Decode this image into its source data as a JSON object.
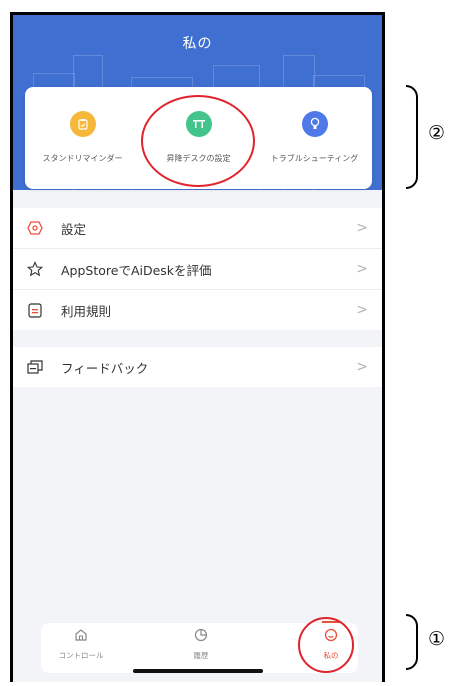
{
  "header": {
    "title": "私の"
  },
  "features": [
    {
      "label": "スタンドリマインダー",
      "icon": "clipboard-icon",
      "color": "#F5B83A"
    },
    {
      "label": "昇降デスクの設定",
      "icon": "desk-icon",
      "color": "#43C48B"
    },
    {
      "label": "トラブルシューティング",
      "icon": "bulb-icon",
      "color": "#4E79E6"
    }
  ],
  "menu": [
    {
      "label": "設定",
      "icon": "settings-icon"
    },
    {
      "label": "AppStoreでAiDeskを評価",
      "icon": "star-icon"
    },
    {
      "label": "利用規則",
      "icon": "document-icon"
    }
  ],
  "feedback": {
    "label": "フィードバック",
    "icon": "feedback-icon"
  },
  "chevron": ">",
  "tabs": [
    {
      "label": "コントロール",
      "icon": "home-icon",
      "active": false
    },
    {
      "label": "履歴",
      "icon": "chart-icon",
      "active": false
    },
    {
      "label": "私の",
      "icon": "face-icon",
      "active": true
    }
  ],
  "annotations": {
    "marker_1": "①",
    "marker_2": "②"
  },
  "colors": {
    "primary": "#3F6FD0",
    "active_tab": "#E8503A",
    "highlight": "#E0232C"
  }
}
